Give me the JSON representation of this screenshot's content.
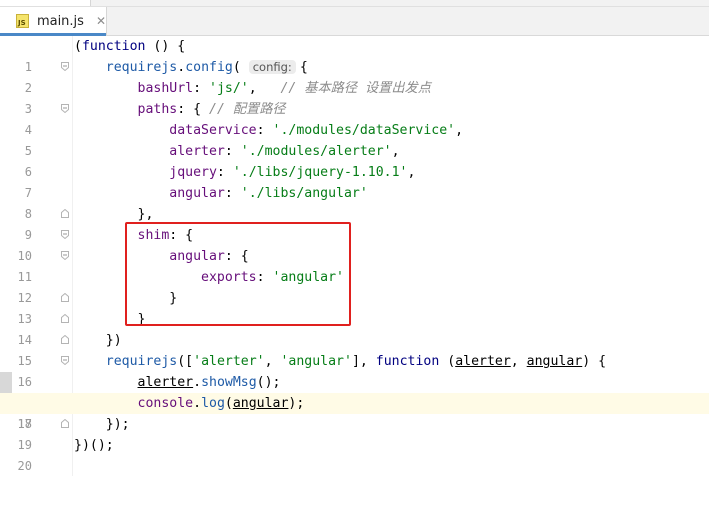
{
  "tabs": {
    "partial_tab_label": "main.js",
    "active_tab": {
      "label": "main.js",
      "close_glyph": "✕",
      "icon_text": "JS"
    }
  },
  "hint": {
    "config": "config:"
  },
  "lines": {
    "n1": "1",
    "n2": "2",
    "n3": "3",
    "n4": "4",
    "n5": "5",
    "n6": "6",
    "n7": "7",
    "n8": "8",
    "n9": "9",
    "n10": "10",
    "n11": "11",
    "n12": "12",
    "n13": "13",
    "n14": "14",
    "n15": "15",
    "n16": "16",
    "n17": "17",
    "n18": "18",
    "n19": "19",
    "n20": "20"
  },
  "code": {
    "l1": {
      "a": "(",
      "kw": "function",
      "b": " () {"
    },
    "l2": {
      "indent": "    ",
      "obj": "requirejs",
      "dot": ".",
      "fn": "config",
      "open": "(",
      "rest": "{"
    },
    "l3": {
      "indent": "        ",
      "prop": "bashUrl",
      "colon": ": ",
      "str": "'js/'",
      "comma": ",   ",
      "comment": "// 基本路径 设置出发点"
    },
    "l4": {
      "indent": "        ",
      "prop": "paths",
      "rest": ": { ",
      "comment": "// 配置路径"
    },
    "l5": {
      "indent": "            ",
      "prop": "dataService",
      "colon": ": ",
      "str": "'./modules/dataService'",
      "comma": ","
    },
    "l6": {
      "indent": "            ",
      "prop": "alerter",
      "colon": ": ",
      "str": "'./modules/alerter'",
      "comma": ","
    },
    "l7": {
      "indent": "            ",
      "prop": "jquery",
      "colon": ": ",
      "str": "'./libs/jquery-1.10.1'",
      "comma": ","
    },
    "l8": {
      "indent": "            ",
      "prop": "angular",
      "colon": ": ",
      "str": "'./libs/angular'"
    },
    "l9": {
      "text": "        },"
    },
    "l10": {
      "indent": "        ",
      "prop": "shim",
      "rest": ": {"
    },
    "l11": {
      "indent": "            ",
      "prop": "angular",
      "rest": ": {"
    },
    "l12": {
      "indent": "                ",
      "prop": "exports",
      "colon": ": ",
      "str": "'angular'"
    },
    "l13": {
      "text": "            }"
    },
    "l14": {
      "text": "        }"
    },
    "l15": {
      "text": "    })"
    },
    "l16": {
      "indent": "    ",
      "fn": "requirejs",
      "a": "([",
      "s1": "'alerter'",
      "c": ", ",
      "s2": "'angular'",
      "b": "], ",
      "kw": "function",
      "p1": " (",
      "arg1": "alerter",
      "sep": ", ",
      "arg2": "angular",
      "end": ") {"
    },
    "l17": {
      "indent": "        ",
      "obj": "alerter",
      "dot": ".",
      "fn": "showMsg",
      "end": "();"
    },
    "l18": {
      "indent": "        ",
      "obj": "console",
      "dot": ".",
      "fn": "log",
      "open": "(",
      "arg": "angular",
      "end": ");"
    },
    "l19": {
      "text": "    });"
    },
    "l20": {
      "text": "})();"
    }
  },
  "colors": {
    "keyword": "#000080",
    "function": "#1e5aa6",
    "property": "#660e7a",
    "string": "#067d17",
    "comment": "#8c8c8c",
    "annotation_box": "#e0201e",
    "current_line": "#fffbe6"
  }
}
